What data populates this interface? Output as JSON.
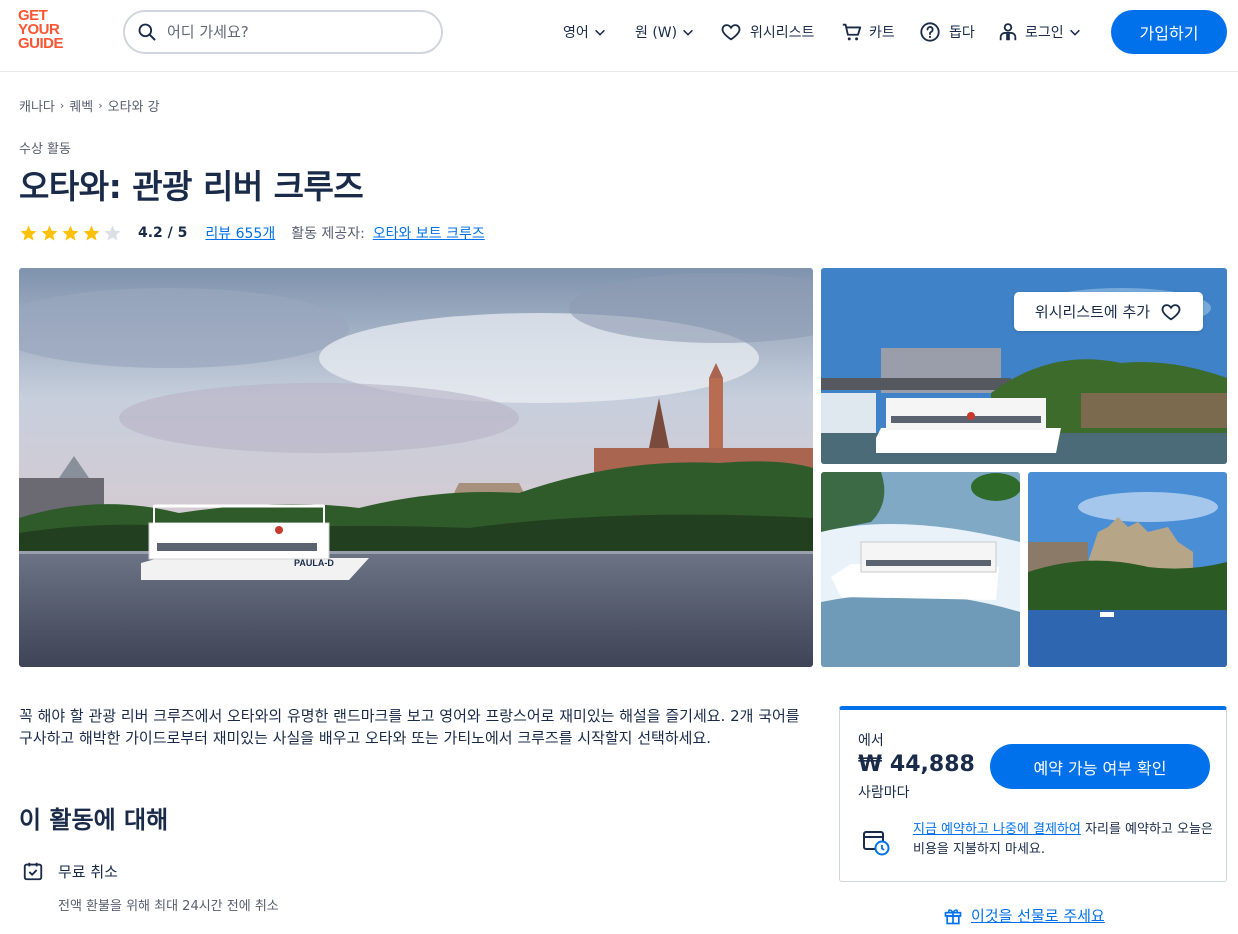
{
  "header": {
    "logo_lines": [
      "GET",
      "YOUR",
      "GUIDE"
    ],
    "search_placeholder": "어디 가세요?",
    "language": "영어",
    "currency": "원 (W)",
    "wishlist": "위시리스트",
    "cart": "카트",
    "help": "돕다",
    "login": "로그인",
    "signup": "가입하기"
  },
  "breadcrumb": [
    "캐나다",
    "퀘벡",
    "오타와 강"
  ],
  "category": "수상 활동",
  "title": "오타와: 관광 리버 크루즈",
  "rating": {
    "stars_filled": 4,
    "stars_total": 5,
    "value": "4.2 / 5",
    "reviews": "리뷰 655개",
    "provider_label": "활동 제공자:",
    "provider": "오타와 보트 크루즈"
  },
  "gallery": {
    "wishlist_add": "위시리스트에 추가",
    "boat_name": "PAULA-D"
  },
  "description": "꼭 해야 할 관광 리버 크루즈에서 오타와의 유명한 랜드마크를 보고 영어와 프랑스어로 재미있는 해설을 즐기세요. 2개 국어를 구사하고 해박한 가이드로부터 재미있는 사실을 배우고 오타와 또는 가티노에서 크루즈를 시작할지 선택하세요.",
  "about": {
    "heading": "이 활동에 대해",
    "feature_title": "무료 취소",
    "feature_sub": "전액 환불을 위해 최대 24시간 전에 취소"
  },
  "booking": {
    "from": "에서",
    "price": "₩ 44,888",
    "per": "사람마다",
    "check_button": "예약 가능 여부 확인",
    "reserve_link": "지금 예약하고 나중에 결제하여",
    "reserve_rest": " 자리를 예약하고 오늘은 비용을 지불하지 마세요.",
    "gift": "이것을 선물로 주세요"
  },
  "colors": {
    "accent": "#0071eb",
    "brand": "#ff5533",
    "star": "#ffc107",
    "text": "#1a2b49"
  }
}
